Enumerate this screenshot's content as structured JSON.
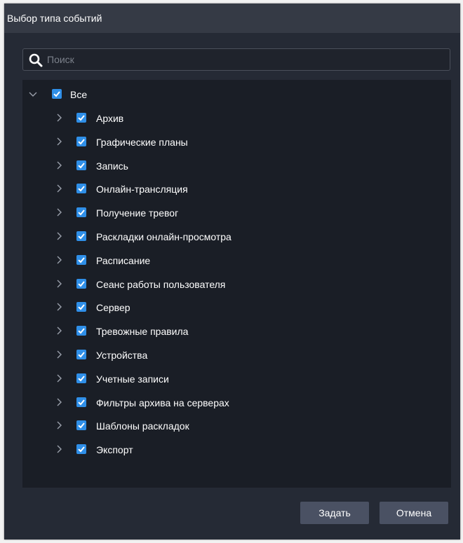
{
  "dialog": {
    "title": "Выбор типа событий"
  },
  "search": {
    "placeholder": "Поиск"
  },
  "tree": {
    "root": {
      "label": "Все",
      "checked": true,
      "expanded": true
    },
    "items": [
      {
        "label": "Архив",
        "checked": true
      },
      {
        "label": "Графические планы",
        "checked": true
      },
      {
        "label": "Запись",
        "checked": true
      },
      {
        "label": "Онлайн-трансляция",
        "checked": true
      },
      {
        "label": "Получение тревог",
        "checked": true
      },
      {
        "label": "Раскладки онлайн-просмотра",
        "checked": true
      },
      {
        "label": "Расписание",
        "checked": true
      },
      {
        "label": "Сеанс работы пользователя",
        "checked": true
      },
      {
        "label": "Сервер",
        "checked": true
      },
      {
        "label": "Тревожные правила",
        "checked": true
      },
      {
        "label": "Устройства",
        "checked": true
      },
      {
        "label": "Учетные записи",
        "checked": true
      },
      {
        "label": "Фильтры архива на серверах",
        "checked": true
      },
      {
        "label": "Шаблоны раскладок",
        "checked": true
      },
      {
        "label": "Экспорт",
        "checked": true
      }
    ]
  },
  "buttons": {
    "ok": "Задать",
    "cancel": "Отмена"
  },
  "colors": {
    "accent": "#2f8fe8",
    "background": "#252a35",
    "tree_background": "#1a1e26"
  }
}
